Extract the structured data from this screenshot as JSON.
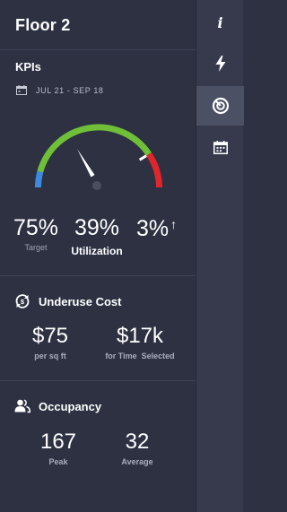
{
  "header": {
    "title": "Floor 2"
  },
  "kpis": {
    "title": "KPIs",
    "date_range": "JUL 21 - SEP 18",
    "gauge": {
      "value_fraction": 0.39,
      "colors": {
        "low": "#3d8be0",
        "mid": "#6fc038",
        "high": "#e0262b",
        "needle": "#ffffff",
        "hub": "#4a4e61"
      }
    },
    "target": {
      "value": "75%",
      "label": "Target"
    },
    "utilization": {
      "value": "39%",
      "label": "Utilization"
    },
    "trend": {
      "value": "3%",
      "arrow": "↑"
    }
  },
  "underuse": {
    "title": "Underuse Cost",
    "per_sqft": {
      "value": "$75",
      "label": "per sq ft"
    },
    "for_time": {
      "value": "$17k",
      "label": "for Time  Selected"
    }
  },
  "occupancy": {
    "title": "Occupancy",
    "peak": {
      "value": "167",
      "label": "Peak"
    },
    "average": {
      "value": "32",
      "label": "Average"
    }
  },
  "rail": {
    "items": [
      {
        "icon": "info-icon",
        "glyph": "i"
      },
      {
        "icon": "lightning-icon"
      },
      {
        "icon": "target-icon",
        "active": true
      },
      {
        "icon": "calendar-icon"
      }
    ]
  },
  "colors": {
    "panel_bg": "#2e3142",
    "rail_bg": "#363a4c",
    "rail_active": "#4b5064",
    "muted_text": "#9da1b2"
  }
}
